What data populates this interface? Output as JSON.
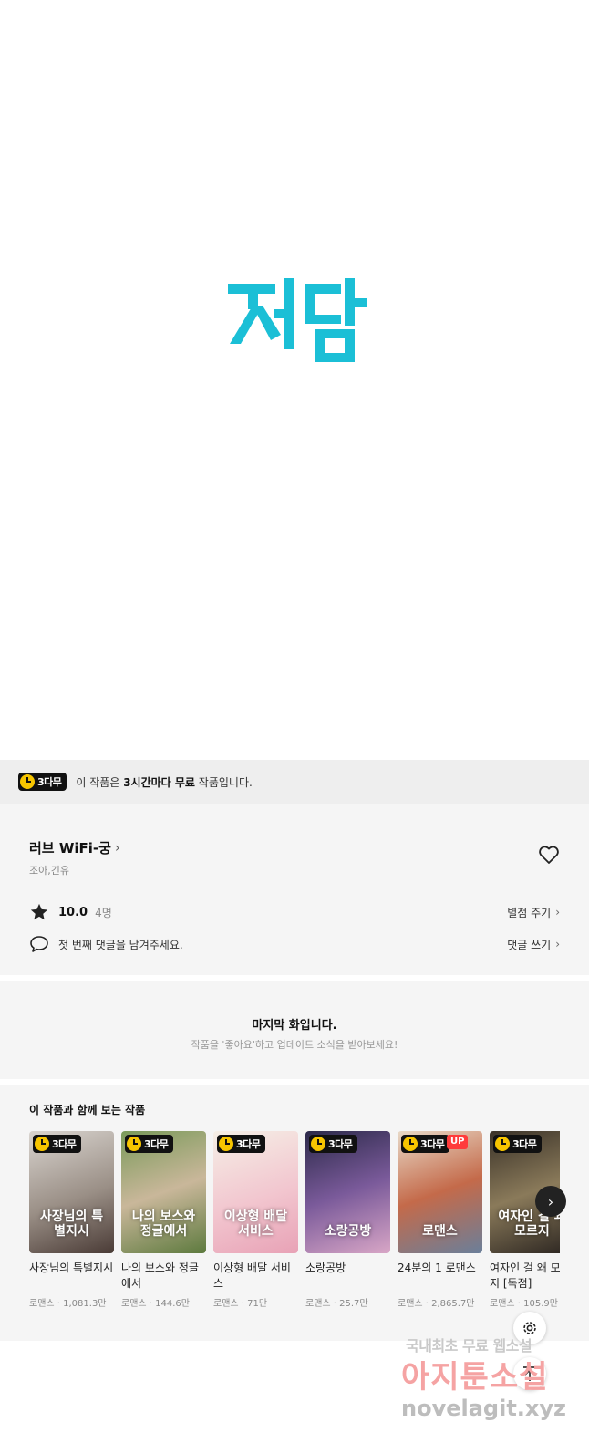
{
  "hero": {
    "logo_text": "재담",
    "logo_color": "#1bbfd6"
  },
  "banner": {
    "badge": "3다무",
    "msg_prefix": "이 작품은 ",
    "msg_bold": "3시간마다 무료",
    "msg_suffix": " 작품입니다."
  },
  "work": {
    "title": "러브 WiFi-궁",
    "author": "조아,긴유",
    "rating": "10.0",
    "rating_count": "4명",
    "rate_link": "별점 주기",
    "comment_placeholder": "첫 번째 댓글을 남겨주세요.",
    "comment_link": "댓글 쓰기"
  },
  "last": {
    "title": "마지막 화입니다.",
    "subtitle": "작품을 '좋아요'하고 업데이트 소식을 받아보세요!"
  },
  "recs": {
    "title": "이 작품과 함께 보는 작품",
    "items": [
      {
        "name": "사장님의 특별지시",
        "art": "사장님의 특별지시",
        "meta": "로맨스 · 1,081.3만",
        "badge": "3다무",
        "up": "",
        "bg": "linear-gradient(160deg,#d9d4cf,#9a8f86 55%,#4a3b36)"
      },
      {
        "name": "나의 보스와 정글에서",
        "art": "나의 보스와 정글에서",
        "meta": "로맨스 · 144.6만",
        "badge": "3다무",
        "up": "",
        "bg": "linear-gradient(160deg,#7a9a5a,#c9b79a 50%,#5d7a3e)"
      },
      {
        "name": "이상형 배달 서비스",
        "art": "이상형 배달 서비스",
        "meta": "로맨스 · 71만",
        "badge": "3다무",
        "up": "",
        "bg": "linear-gradient(160deg,#f5efe6,#f2c6cf 55%,#e8a2b6)"
      },
      {
        "name": "소랑공방",
        "art": "소랑공방",
        "meta": "로맨스 · 25.7만",
        "badge": "3다무",
        "up": "",
        "bg": "linear-gradient(160deg,#2c2a4a,#7a5a9a 50%,#d8a6c6)"
      },
      {
        "name": "24분의 1 로맨스",
        "art": "로맨스",
        "meta": "로맨스 · 2,865.7만",
        "badge": "3다무",
        "up": "UP",
        "bg": "linear-gradient(160deg,#e8d9c7,#c46a4a 50%,#6a7f9a)"
      },
      {
        "name": "여자인 걸 왜 모르지 [독점]",
        "art": "여자인 걸 왜 모르지",
        "meta": "로맨스 · 105.9만",
        "badge": "3다무",
        "up": "",
        "bg": "linear-gradient(160deg,#3a3228,#8a7a5a 50%,#2a2420)"
      }
    ]
  },
  "watermark": {
    "line1": "국내최초 무료 웹소설",
    "line2": "아지툰소설",
    "line3": "novelagit.xyz"
  }
}
